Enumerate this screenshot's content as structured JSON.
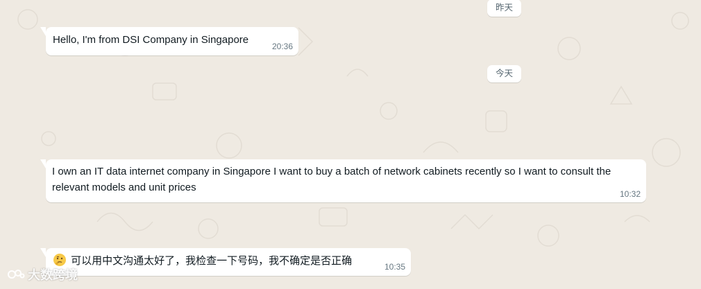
{
  "chat": {
    "date_dividers": {
      "yesterday": "昨天",
      "today": "今天"
    },
    "messages": [
      {
        "text": "Hello, I'm from DSI Company in Singapore",
        "time": "20:36"
      },
      {
        "text": "I own an IT data internet company in Singapore I want to buy a batch of network cabinets recently so I want to consult the relevant models and unit prices",
        "time": "10:32"
      },
      {
        "emoji": "thinking-face",
        "text": "可以用中文沟通太好了，我检查一下号码，我不确定是否正确",
        "time": "10:35"
      }
    ]
  },
  "watermark": {
    "text": "大数跨境"
  },
  "colors": {
    "background": "#efeae2",
    "bubble": "#ffffff",
    "time_text": "#667781"
  }
}
